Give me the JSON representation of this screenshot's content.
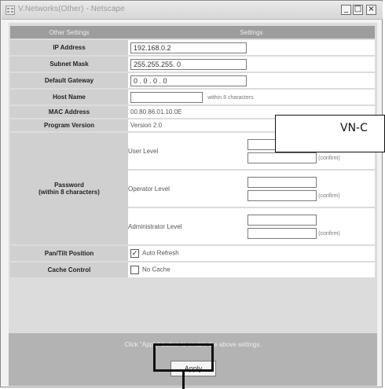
{
  "window": {
    "title": "V.Networks(Other) - Netscape",
    "icon": "network-icon",
    "controls": [
      "_",
      "□",
      "×"
    ]
  },
  "table": {
    "header_left": "Other Settings",
    "header_right": "Settings",
    "ip_label": "IP Address",
    "ip_value": "192.168.0.2",
    "mask_label": "Subnet Mask",
    "mask_value": "255.255.255.  0",
    "gateway_label": "Default Gateway",
    "gateway_value": "  0 .  0 .  0 .  0",
    "host_label": "Host Name",
    "host_value": "",
    "host_note": "within 8 characters",
    "mac_label": "MAC Address",
    "mac_value": "00.80.86.01.10.0E",
    "version_label": "Program Version",
    "version_value": "Version 2.0",
    "password_label": "Password",
    "password_sub": "(within 8 characters)",
    "user_level": "User Level",
    "operator_level": "Operator Level",
    "admin_level": "Administrator Level",
    "confirm": "(confirm)",
    "pantilt_label": "Pan/Tilt Position",
    "pantilt_value": "Auto Refresh",
    "cache_label": "Cache Control",
    "cache_value": "No Cache"
  },
  "footer": {
    "note": "Click \"Apply\" button to enable the above settings.",
    "apply_label": "Apply"
  },
  "callout": {
    "text": "VN-C"
  }
}
